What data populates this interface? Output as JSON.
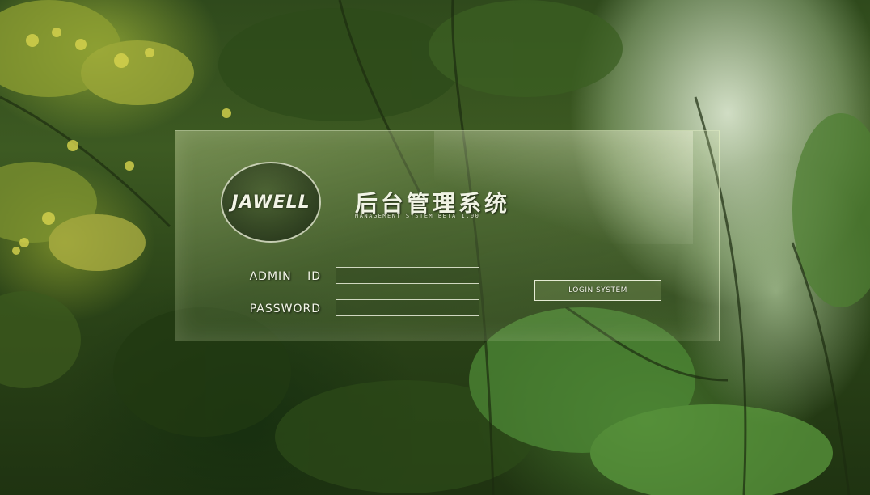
{
  "brand": {
    "logo_text": "JAWELL",
    "title": "后台管理系统",
    "subtitle": "MANAGEMENT SYSTEM BETA 1.00"
  },
  "login_form": {
    "admin_label": "ADMIN ID",
    "admin_value": "",
    "password_label": "PASSWORD",
    "password_value": "",
    "submit_label": "LOGIN SYSTEM"
  },
  "colors": {
    "text": "#f4f6ea",
    "panel_border": "#e6f0c8",
    "foliage_dark": "#1f3311",
    "foliage_mid": "#3d5a22",
    "flower_yellow": "#c8c84a"
  }
}
